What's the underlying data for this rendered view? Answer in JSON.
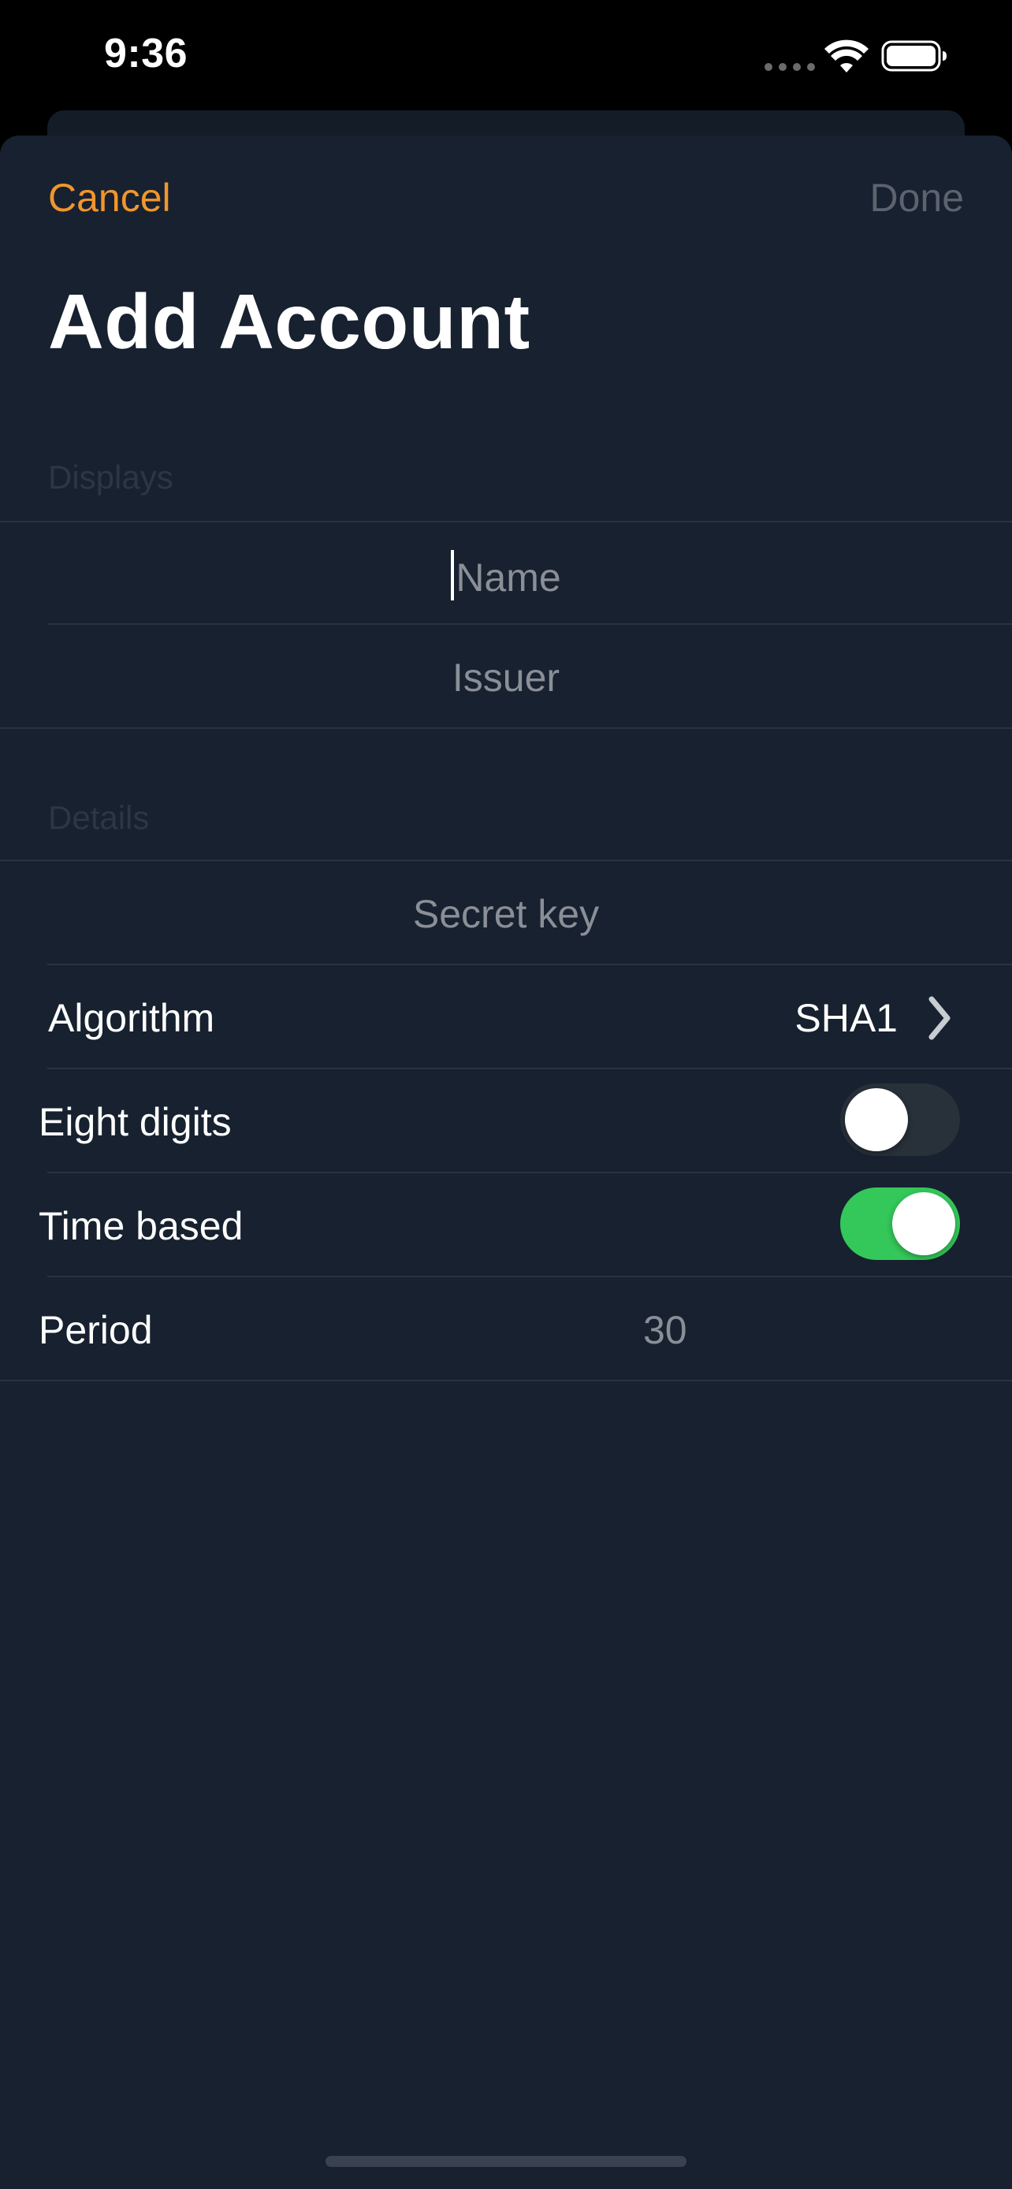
{
  "status_bar": {
    "time": "9:36"
  },
  "nav": {
    "cancel_label": "Cancel",
    "done_label": "Done",
    "title": "Add Account"
  },
  "sections": {
    "displays_header": "Displays",
    "details_header": "Details"
  },
  "fields": {
    "name_placeholder": "Name",
    "issuer_placeholder": "Issuer",
    "secret_key_placeholder": "Secret key"
  },
  "rows": {
    "algorithm_label": "Algorithm",
    "algorithm_value": "SHA1",
    "eight_digits_label": "Eight digits",
    "eight_digits_on": false,
    "time_based_label": "Time based",
    "time_based_on": true,
    "period_label": "Period",
    "period_value": "30"
  },
  "colors": {
    "accent": "#f0962e",
    "toggle_on": "#34c759",
    "toggle_off": "#283039",
    "background": "#17212f"
  },
  "icons": {
    "chevron": "chevron-right-icon",
    "wifi": "wifi-icon",
    "battery": "battery-icon"
  }
}
